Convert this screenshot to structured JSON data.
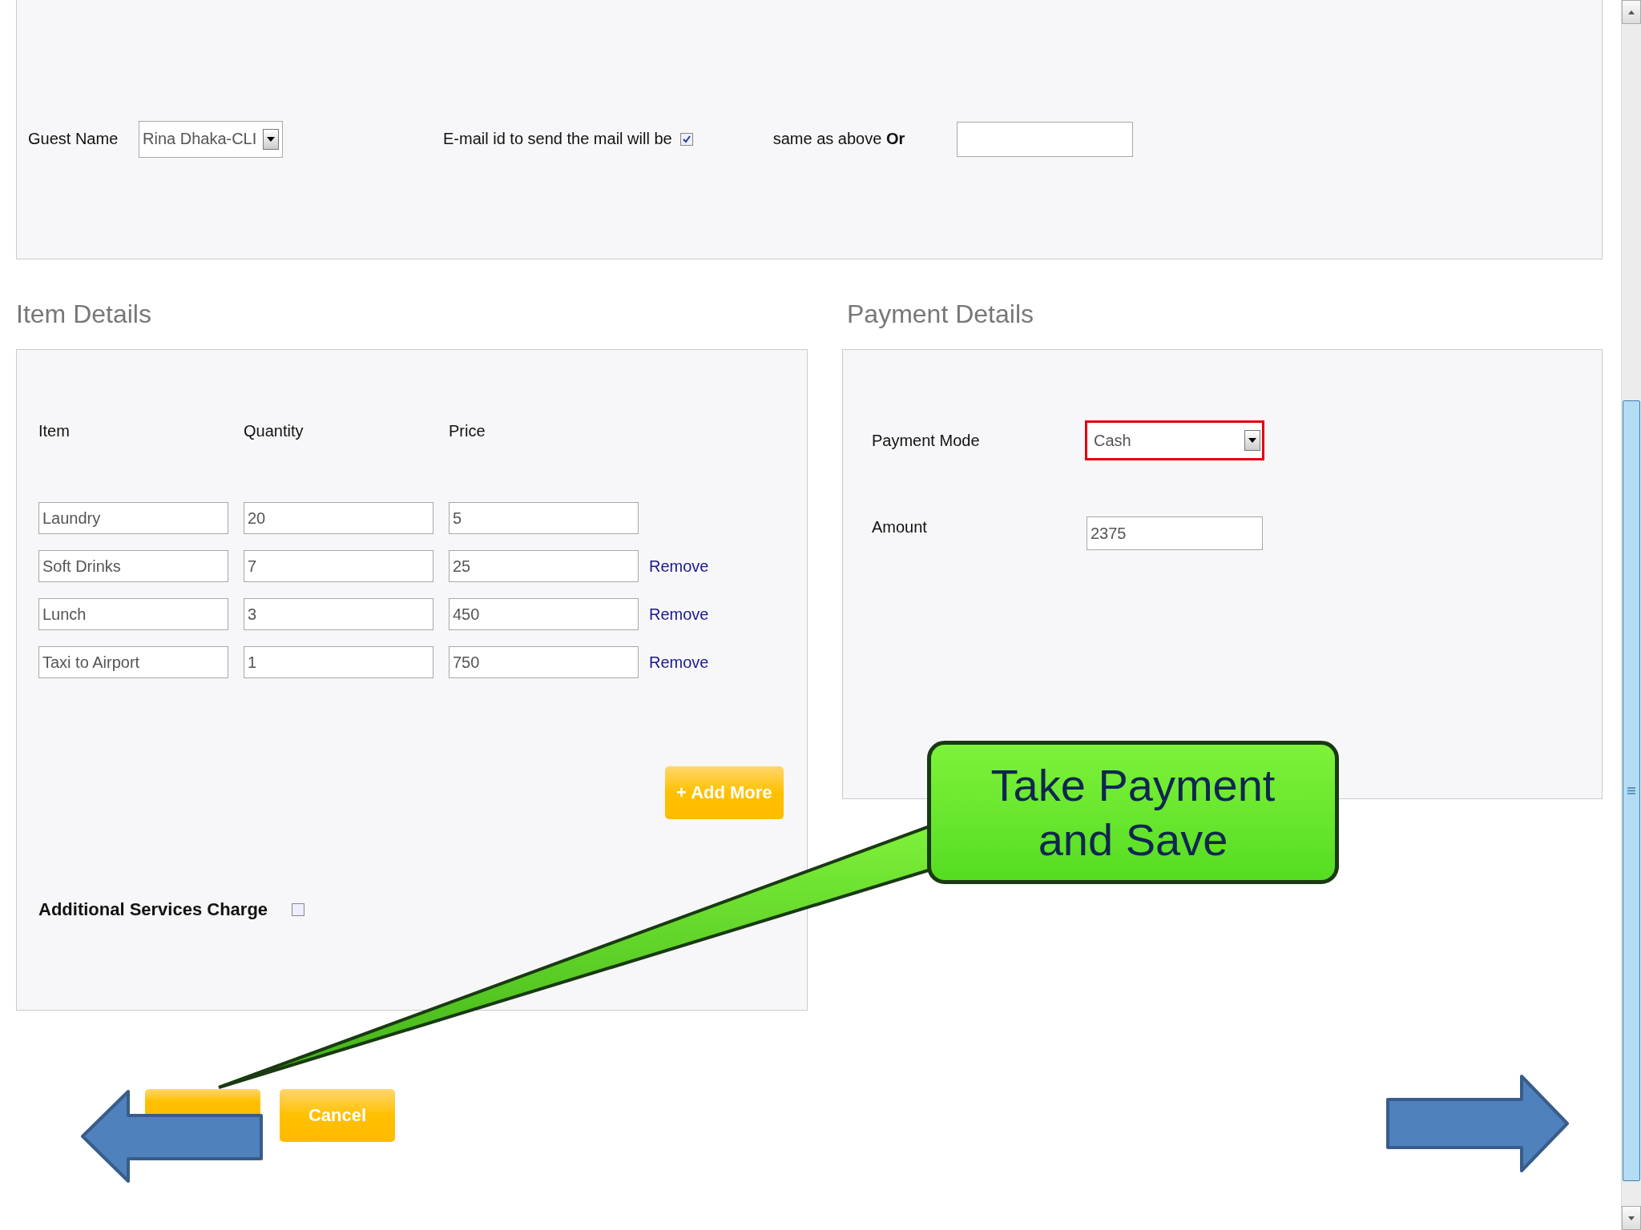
{
  "guest": {
    "label": "Guest Name",
    "value": "Rina Dhaka-CLI"
  },
  "email": {
    "label": "E-mail id to send the mail will be",
    "checked": true,
    "same_as_above": "same as above **Or**"
  },
  "item_details": {
    "title": "Item Details",
    "columns": [
      "Item",
      "Quantity",
      "Price"
    ],
    "rows": [
      {
        "item": "Laundry",
        "quantity": "20",
        "price": "5"
      },
      {
        "item": "Soft Drinks",
        "quantity": "7",
        "price": "25",
        "action": "Remove"
      },
      {
        "item": "Lunch",
        "quantity": "3",
        "price": "450",
        "action": "Remove"
      },
      {
        "item": "Taxi to Airport",
        "quantity": "1",
        "price": "750",
        "action": "Remove"
      }
    ],
    "add_button": "+ Add More",
    "additional_services": {
      "label": "Additional Services Charge",
      "checked": false
    }
  },
  "payment_details": {
    "title": "Payment Details",
    "mode_label": "Payment Mode",
    "mode": "Cash",
    "mode_highlighted": true,
    "amount_label": "Amount",
    "amount": "2375"
  },
  "buttons": [
    {
      "kind": "covered"
    },
    {
      "kind": "labeled",
      "label": "Cancel"
    }
  ],
  "callout": {
    "text": "Take Payment and Save"
  }
}
